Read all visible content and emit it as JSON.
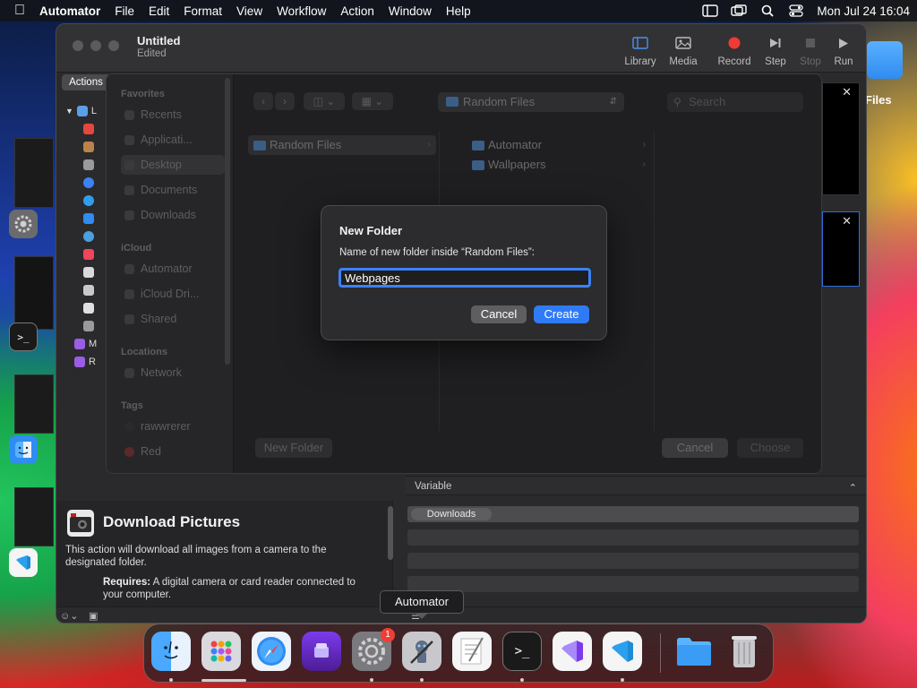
{
  "menubar": {
    "app_name": "Automator",
    "items": [
      "File",
      "Edit",
      "Format",
      "View",
      "Workflow",
      "Action",
      "Window",
      "Help"
    ],
    "clock": "Mon Jul 24  16:04"
  },
  "window": {
    "title": "Untitled",
    "subtitle": "Edited",
    "toolbar": {
      "library": "Library",
      "media": "Media",
      "record": "Record",
      "step": "Step",
      "stop": "Stop",
      "run": "Run"
    },
    "actions_tab": "Actions",
    "library_rows": [
      "L",
      "",
      "",
      "",
      "",
      "",
      "",
      "",
      "",
      "",
      "",
      "",
      "",
      "M",
      "R"
    ],
    "variable_header": "Variable",
    "variable_value": "Downloads",
    "description": {
      "title": "Download Pictures",
      "text": "This action will download all images from a camera to the designated folder.",
      "requires_label": "Requires:",
      "requires_text": "A digital camera or card reader connected to your computer."
    }
  },
  "sheet": {
    "sidebar": {
      "favorites_head": "Favorites",
      "favorites": [
        "Recents",
        "Applicati...",
        "Desktop",
        "Documents",
        "Downloads"
      ],
      "icloud_head": "iCloud",
      "icloud": [
        "Automator",
        "iCloud Dri...",
        "Shared"
      ],
      "locations_head": "Locations",
      "locations": [
        "Network"
      ],
      "tags_head": "Tags",
      "tags": [
        "rawwrerer",
        "Red"
      ]
    },
    "path_popup": "Random Files",
    "search_placeholder": "Search",
    "column1": [
      "Random Files"
    ],
    "column2": [
      "Automator",
      "Wallpapers"
    ],
    "new_folder_button": "New Folder",
    "cancel_button": "Cancel",
    "choose_button": "Choose"
  },
  "dialog": {
    "title": "New Folder",
    "label": "Name of new folder inside “Random Files”:",
    "value": "Webpages",
    "cancel": "Cancel",
    "create": "Create"
  },
  "desktop": {
    "files_label": "Files"
  },
  "tooltip": "Automator",
  "dock": {
    "apps": [
      "Finder",
      "Launchpad",
      "Safari",
      "Simulator",
      "System Settings",
      "Automator",
      "TextEdit",
      "Terminal",
      "Visual Studio",
      "Visual Studio Code",
      "Files",
      "Trash"
    ],
    "settings_badge": "1"
  }
}
